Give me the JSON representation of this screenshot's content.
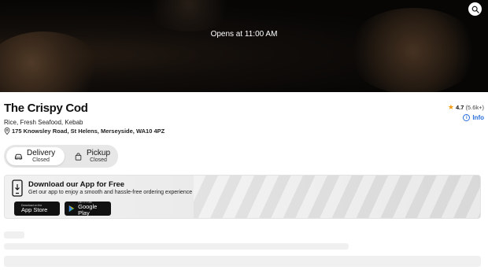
{
  "hero": {
    "opens_text": "Opens at 11:00 AM"
  },
  "restaurant": {
    "name": "The Crispy Cod",
    "cuisines": "Rice, Fresh Seafood, Kebab",
    "address": "175 Knowsley Road, St Helens, Merseyside, WA10 4PZ",
    "rating": "4.7",
    "rating_count": "(5.6k+)",
    "info_label": "Info"
  },
  "fulfilment": {
    "delivery": {
      "label": "Delivery",
      "status": "Closed"
    },
    "pickup": {
      "label": "Pickup",
      "status": "Closed"
    },
    "selected": "delivery"
  },
  "app_banner": {
    "title": "Download our App for Free",
    "subtitle": "Get our app to enjoy a smooth and hassle-free ordering experience",
    "app_store": {
      "small": "Download on the",
      "big": "App Store"
    },
    "google_play": {
      "small": "GET IT ON",
      "big": "Google Play"
    }
  },
  "colors": {
    "rating_star": "#f39c12",
    "info_link": "#2a6fdb",
    "banner_bg": "#eeeeee"
  },
  "icons": [
    "search-icon",
    "location-pin-icon",
    "star-icon",
    "info-icon",
    "car-icon",
    "bag-icon",
    "phone-download-icon",
    "apple-icon",
    "google-play-icon"
  ]
}
